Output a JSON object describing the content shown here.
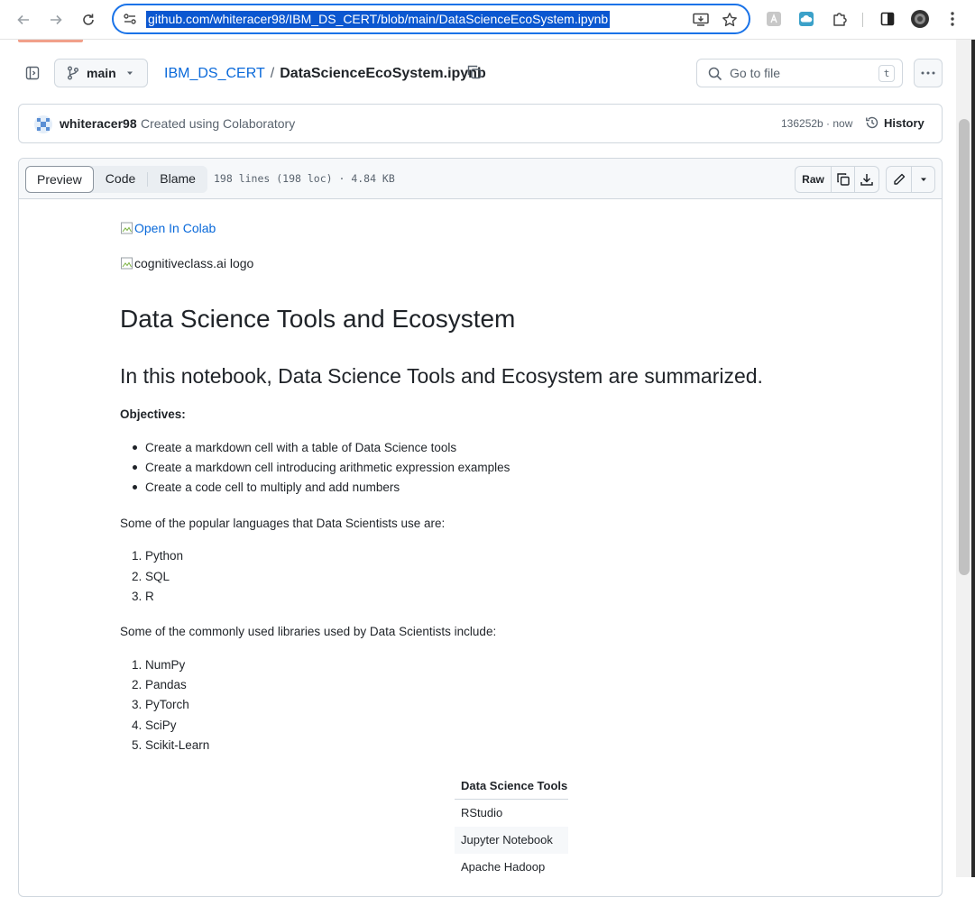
{
  "browser": {
    "url": "github.com/whiteracer98/IBM_DS_CERT/blob/main/DataScienceEcoSystem.ipynb"
  },
  "repo": {
    "branch": "main",
    "repo_name": "IBM_DS_CERT",
    "separator": "/",
    "file_name": "DataScienceEcoSystem.ipynb",
    "goto_placeholder": "Go to file",
    "goto_shortcut": "t"
  },
  "commit": {
    "author": "whiteracer98",
    "message": "Created using Colaboratory",
    "sha_time": "136252b · now",
    "history_label": "History"
  },
  "file": {
    "tabs": [
      "Preview",
      "Code",
      "Blame"
    ],
    "active_tab": "Preview",
    "meta": "198 lines (198 loc) · 4.84 KB",
    "raw_label": "Raw"
  },
  "notebook": {
    "colab_badge_alt": "Open In Colab",
    "logo_alt": "cognitiveclass.ai logo",
    "title": "Data Science Tools and Ecosystem",
    "subtitle": "In this notebook, Data Science Tools and Ecosystem are summarized.",
    "objectives_label": "Objectives:",
    "objectives": [
      "Create a markdown cell with a table of Data Science tools",
      "Create a markdown cell introducing arithmetic expression examples",
      "Create a code cell to multiply and add numbers"
    ],
    "languages_intro": "Some of the popular languages that Data Scientists use are:",
    "languages": [
      "Python",
      "SQL",
      "R"
    ],
    "libraries_intro": "Some of the commonly used libraries used by Data Scientists include:",
    "libraries": [
      "NumPy",
      "Pandas",
      "PyTorch",
      "SciPy",
      "Scikit-Learn"
    ],
    "tools_table": {
      "header": "Data Science Tools",
      "rows": [
        "RStudio",
        "Jupyter Notebook",
        "Apache Hadoop"
      ]
    },
    "list_numbers": [
      "1.",
      "2.",
      "3.",
      "4.",
      "5."
    ]
  },
  "colors": {
    "link": "#0969da",
    "omnibox_border": "#1a73e8",
    "url_selection": "#0b57d0"
  }
}
